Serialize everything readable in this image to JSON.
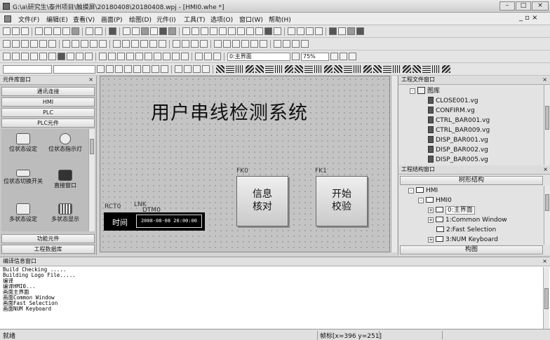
{
  "window": {
    "title": "G:\\a\\研究生\\泰州项目\\触摸屏\\20180408\\20180408.wpj - [HMI0.whe *]",
    "min": "–",
    "max": "□",
    "close": "×"
  },
  "menu": [
    "文件(F)",
    "编辑(E)",
    "查看(V)",
    "画面(P)",
    "绘图(D)",
    "元件(I)",
    "工具(T)",
    "选项(O)",
    "窗口(W)",
    "帮助(H)"
  ],
  "toolbar": {
    "screen_select": "0:主界面",
    "zoom": "75%"
  },
  "left_panel": {
    "title": "元件库窗口",
    "categories": [
      "通讯连接",
      "HMI",
      "PLC",
      "PLC元件"
    ],
    "items": [
      {
        "label": "位状态设定",
        "icon": "bit-set-icon"
      },
      {
        "label": "位状态指示灯",
        "icon": "bulb-icon"
      },
      {
        "label": "位状态切换开关",
        "icon": "toggle-switch-icon"
      },
      {
        "label": "直接窗口",
        "icon": "direct-window-icon"
      },
      {
        "label": "多状态设定",
        "icon": "multi-set-icon"
      },
      {
        "label": "多状态显示",
        "icon": "multi-display-icon"
      }
    ],
    "bottom_tabs": [
      "功能元件",
      "工程数据库"
    ]
  },
  "canvas": {
    "title": "用户串线检测系统",
    "rct_label": "RCT0",
    "lnk_label": "LNK",
    "dtm_label": "DTM0",
    "time_label": "时间",
    "datetime": "2008-08-08 20:00:00",
    "btn1": {
      "tag": "FK0",
      "line1": "信息",
      "line2": "核对"
    },
    "btn2": {
      "tag": "FK1",
      "line1": "开始",
      "line2": "校验"
    }
  },
  "project_files": {
    "title": "工程文件窗口",
    "folder": "图库",
    "files": [
      "CLOSE001.vg",
      "CONFIRM.vg",
      "CTRL_BAR001.vg",
      "CTRL_BAR009.vg",
      "DISP_BAR001.vg",
      "DISP_BAR002.vg",
      "DISP_BAR005.vg"
    ]
  },
  "project_structure": {
    "title": "工程结构窗口",
    "header": "树形结构",
    "root": "HMI",
    "child": "HMI0",
    "screens": [
      "0:主界面",
      "1:Common Window",
      "2:Fast Selection",
      "3:NUM Keyboard"
    ],
    "bottom_tab": "构图"
  },
  "output": {
    "title": "编译信息窗口",
    "lines": [
      "Build Checking .....",
      "Building Logo File.....",
      "编译",
      "编译HMI0...",
      "画面主界面",
      "画面Common Window",
      "画面Fast Selection",
      "画面NUM Keyboard"
    ]
  },
  "status": {
    "ready": "就绪",
    "coords": "帧标[x=396 y=251]"
  }
}
